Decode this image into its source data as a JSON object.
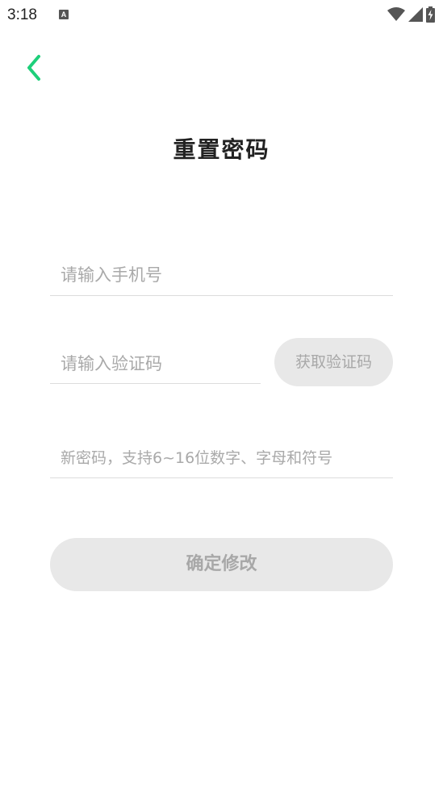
{
  "status_bar": {
    "time": "3:18",
    "notification_icon": "font-a-icon",
    "icons": [
      "wifi-icon",
      "cell-signal-icon",
      "battery-charging-icon"
    ]
  },
  "header": {
    "back_icon": "chevron-left-icon",
    "accent_color": "#1ecf7a",
    "title": "重置密码"
  },
  "form": {
    "phone": {
      "placeholder": "请输入手机号",
      "value": ""
    },
    "code": {
      "placeholder": "请输入验证码",
      "value": ""
    },
    "get_code_label": "获取验证码",
    "password": {
      "placeholder": "新密码，支持6~16位数字、字母和符号",
      "value": ""
    },
    "confirm_label": "确定修改",
    "disabled_button_color": "#e8e8e8",
    "disabled_text_color": "#a8a8a8"
  }
}
